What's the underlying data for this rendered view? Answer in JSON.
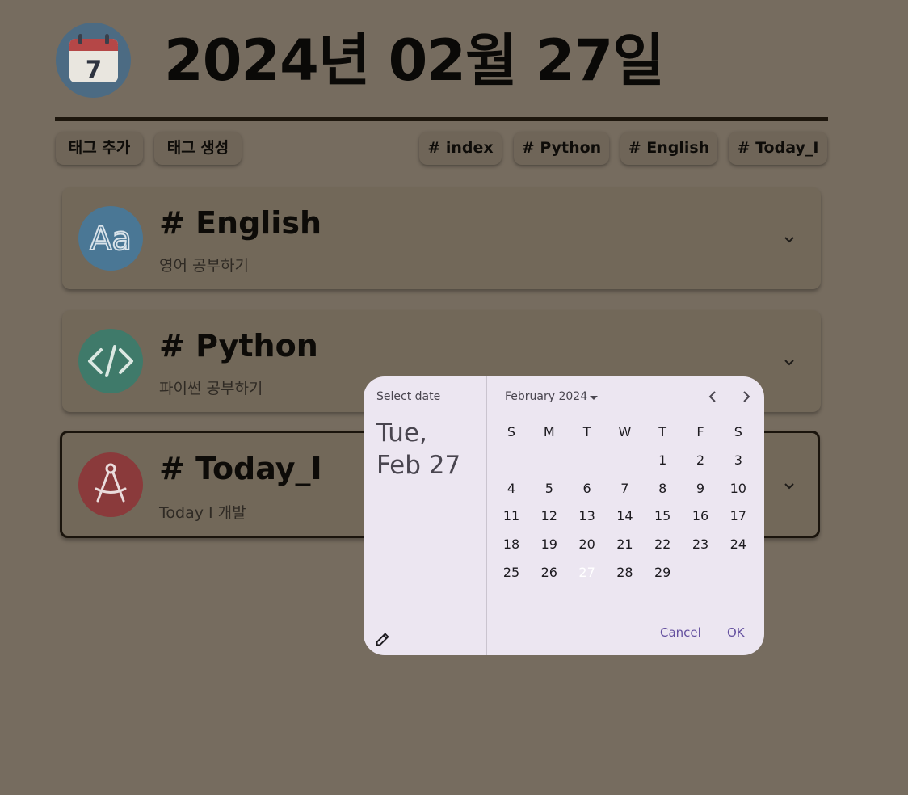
{
  "header": {
    "title": "2024년 02월 27일",
    "calendar_icon_day": "7"
  },
  "actions": {
    "add_tag": "태그 추가",
    "create_tag": "태그 생성"
  },
  "tag_chips": [
    "# index",
    "# Python",
    "# English",
    "# Today_I"
  ],
  "cards": [
    {
      "title": "# English",
      "subtitle": "영어 공부하기",
      "icon": "alphabet-aa-icon",
      "color": "#4a7795"
    },
    {
      "title": "# Python",
      "subtitle": "파이썬 공부하기",
      "icon": "code-brackets-icon",
      "color": "#3f7a6a"
    },
    {
      "title": "# Today_I",
      "subtitle": "Today I 개발",
      "icon": "compass-drafting-icon",
      "color": "#8a3a3b"
    }
  ],
  "date_picker": {
    "help_text": "Select date",
    "headline_line1": "Tue,",
    "headline_line2": "Feb 27",
    "month_label": "February 2024",
    "weekdays": [
      "S",
      "M",
      "T",
      "W",
      "T",
      "F",
      "S"
    ],
    "first_weekday_index": 4,
    "days_in_month": 29,
    "selected_day": 27,
    "cancel_label": "Cancel",
    "ok_label": "OK",
    "accent": "#64509f"
  }
}
